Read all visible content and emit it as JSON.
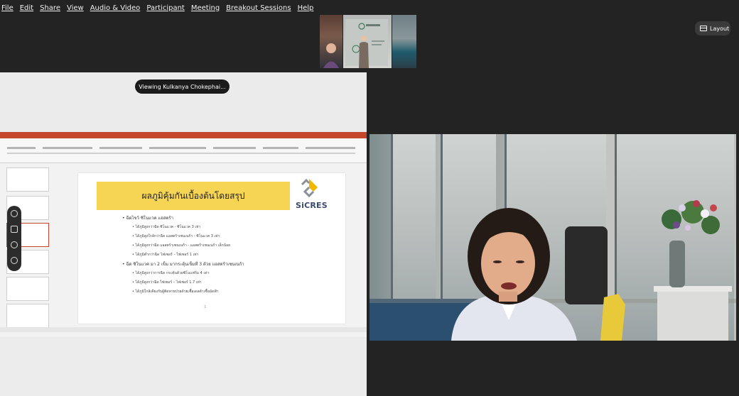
{
  "menu": [
    "File",
    "Edit",
    "Share",
    "View",
    "Audio & Video",
    "Participant",
    "Meeting",
    "Breakout Sessions",
    "Help"
  ],
  "layout_button": {
    "label": "Layout",
    "icon": "layout-icon"
  },
  "viewing_label": "Viewing Kulkanya Chokephai...",
  "slide": {
    "title": "ผลภูมิคุ้มกันเบื้องต้นโดยสรุป",
    "logo_text": "SiCRES",
    "bullets": [
      {
        "text": "ฉีดไขว้ ซิโนแวค แอสตร้า",
        "sub": [
          "ได้ภูมิสูงกว่าฉีด ซิโนแวค - ซิโนแวค 3 เท่า",
          "ได้ภูมิสูงใกล้กว่าฉีด แอสตร้าเซนเนก้า - ซิโนแวค 3 เท่า",
          "ได้ภูมิสูงกว่าฉีด แอสตร้าเซนเนก้า - แอสตร้าเซนเนก้า เล็กน้อย",
          "ได้ภูมิต่ำกว่าฉีด ไฟเซอร์ – ไฟเซอร์ 1 เท่า"
        ]
      },
      {
        "text": "ฉีด ซิโนแวค มา 2 เข็ม มากระตุ้นเข็มที่ 3 ด้วย แอสตร้าเซนเนก้า",
        "sub": [
          "ได้ภูมิสูงกว่าการฉีด กระตุ้นด้วยซิโนแฟร์ม 4 เท่า",
          "ได้ภูมิสูงกว่าฉีด ไฟเซอร์ – ไฟเซอร์ 1.7 เท่า",
          "ได้ภูมิใกล้เคียงกับผู้ติดหายป่วยด้วยเชื้อเดลต้าเชื้อมัดฟ้า"
        ]
      }
    ],
    "page_number": "1"
  },
  "colors": {
    "accent_yellow": "#f6d454",
    "ppt_red": "#c6462b",
    "background": "#232323"
  }
}
